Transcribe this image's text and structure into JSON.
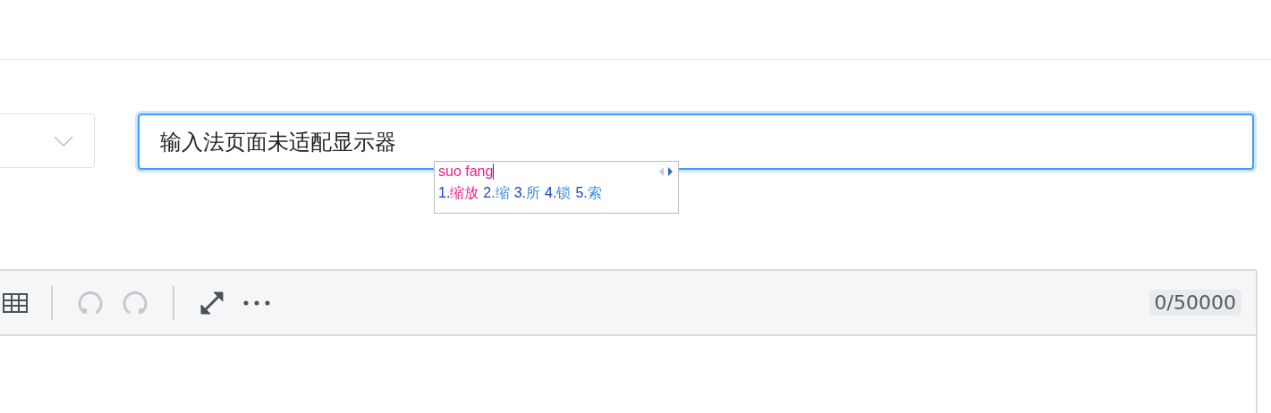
{
  "select": {
    "expanded": false
  },
  "title_input": {
    "value": "输入法页面未适配显示器"
  },
  "ime": {
    "composition": "suo fang",
    "candidates": [
      {
        "number": "1.",
        "text": "缩放",
        "selected": true
      },
      {
        "number": "2.",
        "text": "缩",
        "selected": false
      },
      {
        "number": "3.",
        "text": "所",
        "selected": false
      },
      {
        "number": "4.",
        "text": "锁",
        "selected": false
      },
      {
        "number": "5.",
        "text": "索",
        "selected": false
      }
    ]
  },
  "toolbar": {
    "groups": [
      [
        {
          "kind": "table",
          "disabled": false
        }
      ],
      [
        {
          "kind": "undo",
          "disabled": true
        },
        {
          "kind": "redo",
          "disabled": true
        }
      ],
      [
        {
          "kind": "fullscreen",
          "disabled": false
        },
        {
          "kind": "more",
          "disabled": false
        }
      ]
    ],
    "counter": "0/50000"
  }
}
